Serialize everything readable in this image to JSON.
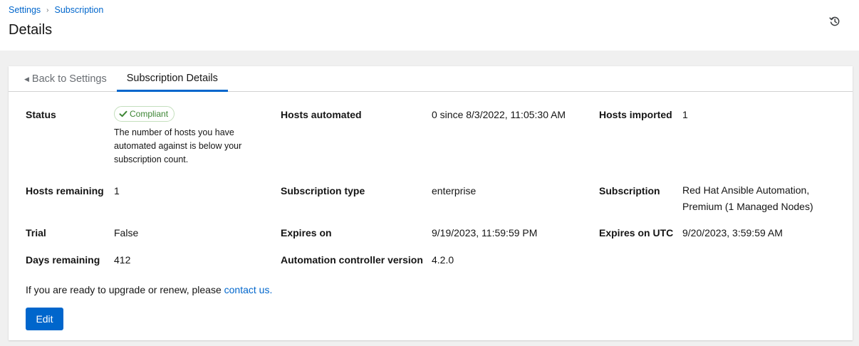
{
  "breadcrumb": {
    "items": [
      "Settings",
      "Subscription"
    ],
    "separator": "›"
  },
  "header": {
    "title": "Details",
    "history_icon": "history-icon"
  },
  "tabs": [
    {
      "label": "Back to Settings",
      "icon": "caret-left-icon"
    },
    {
      "label": "Subscription Details",
      "active": true
    }
  ],
  "details": {
    "status": {
      "label": "Status",
      "badge": "Compliant",
      "badge_icon": "check-icon",
      "helper": "The number of hosts you have automated against is below your subscription count."
    },
    "hosts_automated": {
      "label": "Hosts automated",
      "value": "0 since 8/3/2022, 11:05:30 AM"
    },
    "hosts_imported": {
      "label": "Hosts imported",
      "value": "1"
    },
    "hosts_remaining": {
      "label": "Hosts remaining",
      "value": "1"
    },
    "subscription_type": {
      "label": "Subscription type",
      "value": "enterprise"
    },
    "subscription": {
      "label": "Subscription",
      "value": "Red Hat Ansible Automation, Premium (1 Managed Nodes)"
    },
    "trial": {
      "label": "Trial",
      "value": "False"
    },
    "expires_on": {
      "label": "Expires on",
      "value": "9/19/2023, 11:59:59 PM"
    },
    "expires_on_utc": {
      "label": "Expires on UTC",
      "value": "9/20/2023, 3:59:59 AM"
    },
    "days_remaining": {
      "label": "Days remaining",
      "value": "412"
    },
    "controller_version": {
      "label": "Automation controller version",
      "value": "4.2.0"
    }
  },
  "footer": {
    "text": "If you are ready to upgrade or renew, please ",
    "link": "contact us.",
    "edit_label": "Edit"
  },
  "colors": {
    "accent": "#0066cc",
    "success": "#3e8635",
    "background": "#f0f0f0"
  }
}
